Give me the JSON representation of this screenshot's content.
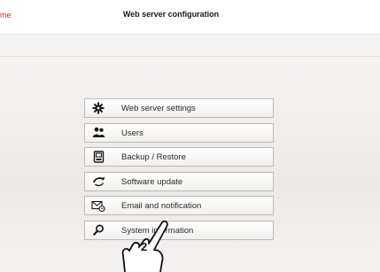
{
  "header": {
    "home_link": "me",
    "title": "Web server configuration"
  },
  "menu": {
    "items": [
      {
        "label": "Web server settings",
        "icon": "gear-icon"
      },
      {
        "label": "Users",
        "icon": "users-icon"
      },
      {
        "label": "Backup / Restore",
        "icon": "backup-icon"
      },
      {
        "label": "Software update",
        "icon": "update-icon"
      },
      {
        "label": "Email and notification",
        "icon": "email-icon"
      },
      {
        "label": "System information",
        "icon": "search-icon"
      }
    ]
  },
  "annotation": {
    "number": "2"
  },
  "colors": {
    "link": "#b23a2a",
    "button_border": "#bdb9b5"
  }
}
